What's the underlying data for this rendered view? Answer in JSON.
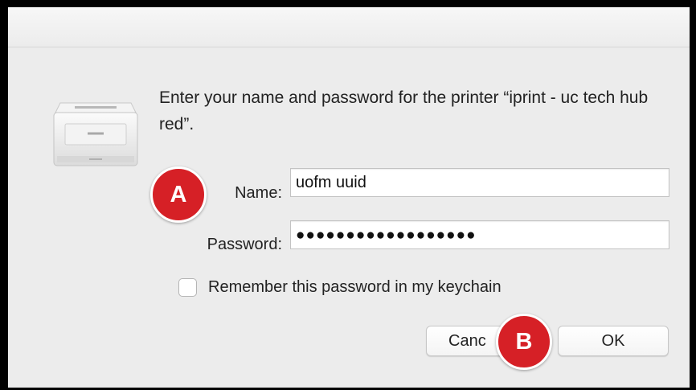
{
  "dialog": {
    "message": "Enter your name and password for the printer “iprint - uc tech hub red”.",
    "name_label": "Name:",
    "name_value": "uofm uuid",
    "password_label": "Password:",
    "password_value": "●●●●●●●●●●●●●●●●●●",
    "remember_label": "Remember this password in my keychain",
    "remember_checked": false,
    "cancel_label": "Canc",
    "ok_label": "OK"
  },
  "annotations": {
    "badge_a": "A",
    "badge_b": "B",
    "badge_color": "#d62026"
  },
  "icons": {
    "printer": "printer-icon"
  }
}
